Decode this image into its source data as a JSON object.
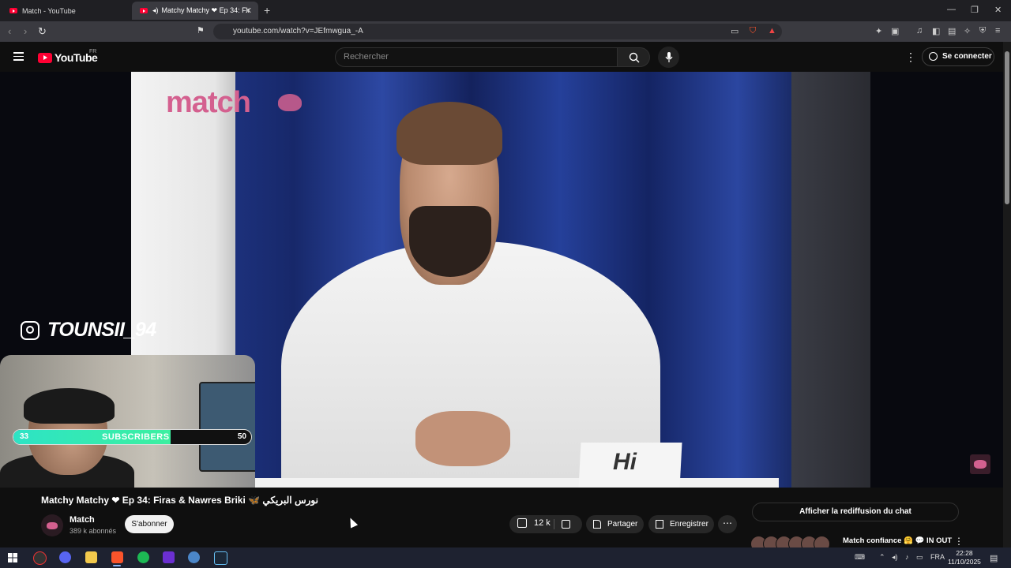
{
  "browser": {
    "tabs": [
      {
        "title": "Match - YouTube",
        "active": false
      },
      {
        "title": "Matchy Matchy ❤ Ep 34: Fir",
        "active": true
      }
    ],
    "new_tab": "+",
    "window_controls": [
      "—",
      "❐",
      "✕"
    ],
    "url": "youtube.com/watch?v=JEfmwgua_-A",
    "back_icon": "‹",
    "forward_icon": "›",
    "reload_icon": "↻",
    "tab_close": "✕"
  },
  "youtube": {
    "logo": "YouTube",
    "region": "FR",
    "search_placeholder": "Rechercher",
    "sign_in": "Se connecter",
    "menu_more": "⋮"
  },
  "video": {
    "brand_text": "match",
    "card_text": "Hi",
    "instagram_handle": "TOUNSII_94",
    "title": "Matchy Matchy ❤ Ep 34: Firas & Nawres Briki 🦋 نورس البريكي"
  },
  "overlay": {
    "sub_current": "33",
    "sub_label": "SUBSCRIBERS",
    "sub_goal": "50",
    "sub_progress": 0.66
  },
  "channel": {
    "name": "Match",
    "subscribers": "389 k abonnés",
    "subscribe": "S'abonner"
  },
  "actions": {
    "likes": "12 k",
    "share": "Partager",
    "save": "Enregistrer",
    "more": "⋯"
  },
  "sidebar": {
    "chat_replay": "Afficher la rediffusion du chat",
    "rec_title": "Match confiance 🤗 💬 IN OUT",
    "rec_more": "⋮"
  },
  "taskbar": {
    "language": "FRA",
    "time": "22:28",
    "date": "11/10/2025"
  },
  "colors": {
    "brand_pink": "#d4608f",
    "youtube_red": "#ff0033",
    "sub_bar": "#2de3c5"
  }
}
